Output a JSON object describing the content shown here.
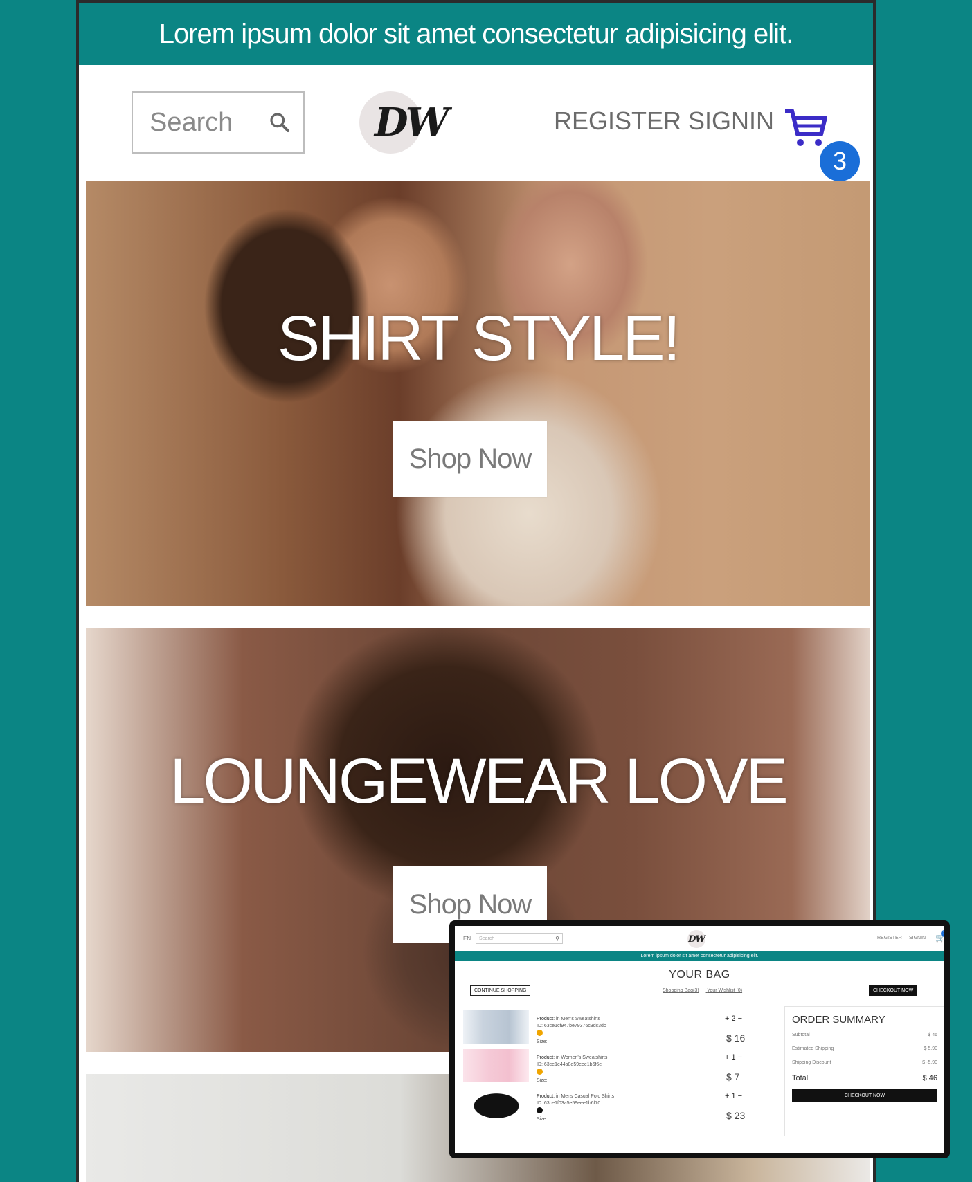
{
  "announcement": "Lorem ipsum dolor sit amet consectetur adipisicing elit.",
  "header": {
    "search_placeholder": "Search",
    "logo": "DW",
    "register": "REGISTER",
    "signin": "SIGNIN",
    "cart_count": "3"
  },
  "heroes": [
    {
      "title": "SHIRT STYLE!",
      "button": "Shop Now"
    },
    {
      "title": "LOUNGEWEAR LOVE",
      "button": "Shop Now"
    }
  ],
  "inset": {
    "lang": "EN",
    "search_placeholder": "Search",
    "logo": "DW",
    "register": "REGISTER",
    "signin": "SIGNIN",
    "cart_count": "3",
    "announcement": "Lorem ipsum dolor sit amet consectetur adipisicing elit.",
    "title": "YOUR BAG",
    "continue": "CONTINUE SHOPPING",
    "tab_bag": "Shopping Bag(3)",
    "tab_wishlist": "Your Wishlist (0)",
    "checkout_top": "CHECKOUT NOW",
    "products": [
      {
        "product_label": "Product:",
        "name": "in Men's Sweatshirts",
        "id": "ID: 63ce1cf947be79376c3dc3dc",
        "size_label": "Size:",
        "qty": "+ 2 −",
        "price": "$ 16",
        "color": "#f0a500"
      },
      {
        "product_label": "Product:",
        "name": "in Women's Sweatshirts",
        "id": "ID: 63ce1e44a8e59eee1b6f6e",
        "size_label": "Size:",
        "qty": "+ 1 −",
        "price": "$ 7",
        "color": "#f0a500"
      },
      {
        "product_label": "Product:",
        "name": "in Mens Casual Polo Shirts",
        "id": "ID: 63ce1f03a5e59eee1b6f70",
        "size_label": "Size:",
        "qty": "+ 1 −",
        "price": "$ 23",
        "color": "#111111"
      }
    ],
    "summary": {
      "title": "ORDER SUMMARY",
      "subtotal_label": "Subtotal",
      "subtotal": "$ 46",
      "shipping_label": "Estimated Shipping",
      "shipping": "$ 5.90",
      "discount_label": "Shipping Discount",
      "discount": "$ -5.90",
      "total_label": "Total",
      "total": "$ 46",
      "checkout": "CHECKOUT NOW"
    }
  },
  "colors": {
    "teal": "#0b8584",
    "badge": "#1a6ed8",
    "cart": "#3b2cc7"
  }
}
